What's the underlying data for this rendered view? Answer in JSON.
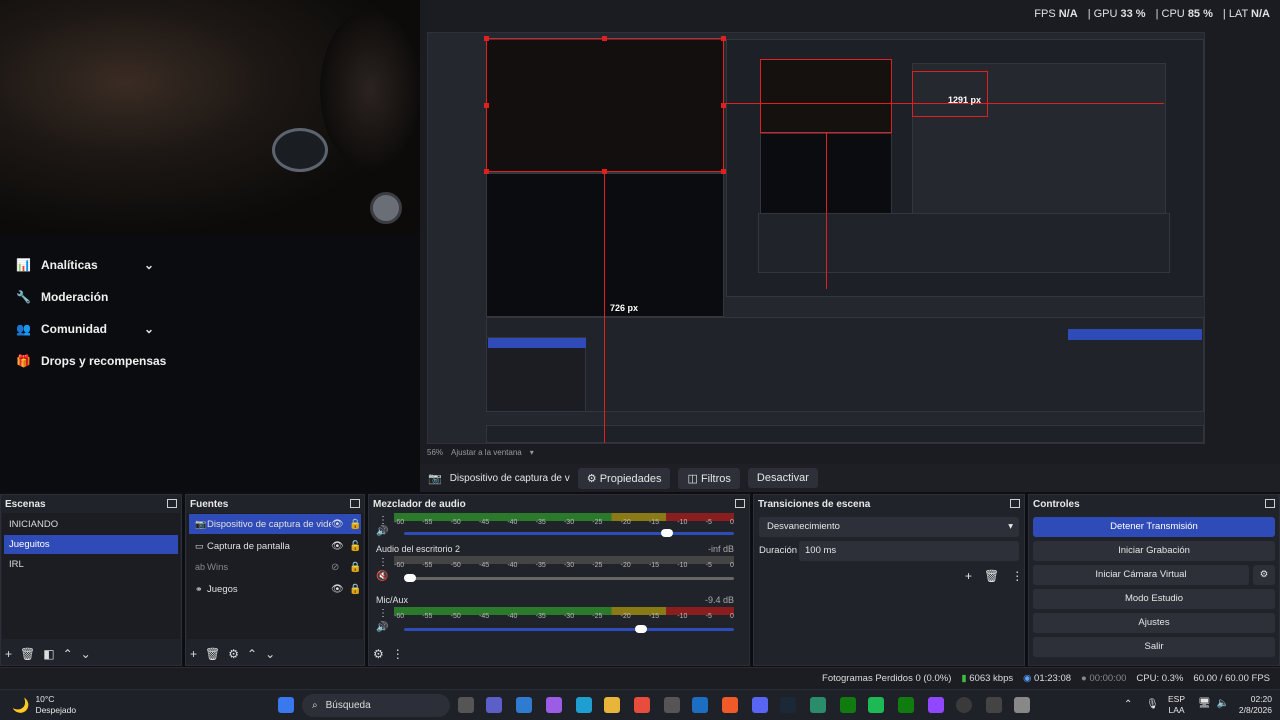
{
  "stats": {
    "fps_label": "FPS",
    "fps_value": "N/A",
    "gpu_label": "GPU",
    "gpu_value": "33 %",
    "cpu_label": "CPU",
    "cpu_value": "85 %",
    "lat_label": "LAT",
    "lat_value": "N/A"
  },
  "side_menu": {
    "items": [
      {
        "label": "Analíticas",
        "icon": "chart-icon",
        "chevron": true
      },
      {
        "label": "Moderación",
        "icon": "wrench-icon",
        "chevron": false
      },
      {
        "label": "Comunidad",
        "icon": "people-icon",
        "chevron": true
      },
      {
        "label": "Drops y recompensas",
        "icon": "gift-icon",
        "chevron": false
      }
    ]
  },
  "preview": {
    "measure_w": "1291 px",
    "measure_h": "726 px",
    "zoom": "56%",
    "zoom_mode": "Ajustar a la ventana"
  },
  "source_bar": {
    "source_name": "Dispositivo de captura de v",
    "properties": "Propiedades",
    "filters": "Filtros",
    "deactivate": "Desactivar"
  },
  "scenes": {
    "title": "Escenas",
    "items": [
      "INICIANDO",
      "Jueguitos",
      "IRL"
    ],
    "selected": "Jueguitos"
  },
  "sources": {
    "title": "Fuentes",
    "items": [
      {
        "name": "Dispositivo de captura de video",
        "icon": "camera-icon"
      },
      {
        "name": "Captura de pantalla",
        "icon": "monitor-icon"
      },
      {
        "name": "Wins",
        "icon": "text-icon"
      },
      {
        "name": "Juegos",
        "icon": "link-icon"
      }
    ]
  },
  "mixer": {
    "title": "Mezclador de audio",
    "scale": [
      "-60",
      "-55",
      "-50",
      "-45",
      "-40",
      "-35",
      "-30",
      "-25",
      "-20",
      "-15",
      "-10",
      "-5",
      "0"
    ],
    "channels": [
      {
        "name": "",
        "db": ""
      },
      {
        "name": "Audio del escritorio 2",
        "db": "-inf dB"
      },
      {
        "name": "Mic/Aux",
        "db": "-9.4 dB"
      }
    ]
  },
  "transitions": {
    "title": "Transiciones de escena",
    "selected": "Desvanecimiento",
    "duration_label": "Duración",
    "duration_value": "100 ms"
  },
  "controls": {
    "title": "Controles",
    "buttons": [
      "Detener Transmisión",
      "Iniciar Grabación",
      "Iniciar Cámara Virtual",
      "Modo Estudio",
      "Ajustes",
      "Salir"
    ]
  },
  "status": {
    "dropped": "Fotogramas Perdidos 0 (0.0%)",
    "bitrate": "6063 kbps",
    "live_time": "01:23:08",
    "rec_time": "00:00:00",
    "cpu": "CPU: 0.3%",
    "fps": "60.00 / 60.00 FPS"
  },
  "taskbar": {
    "weather_temp": "10°C",
    "weather_desc": "Despejado",
    "search": "Búsqueda",
    "lang_top": "ESP",
    "lang_bottom": "LAA",
    "time": "02:20",
    "date": "2/8/2026",
    "colors": {
      "accent": "#2f4bb7",
      "red": "#e02020"
    }
  }
}
